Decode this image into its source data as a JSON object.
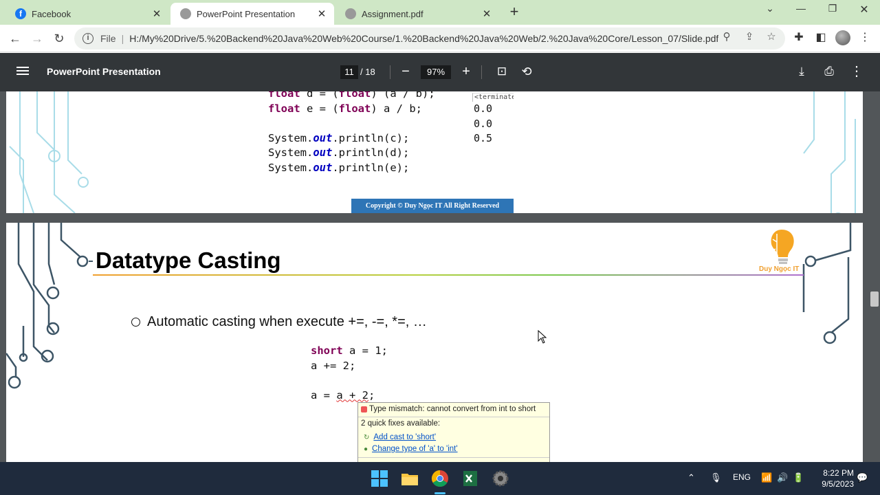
{
  "browser": {
    "tabs": [
      {
        "title": "Facebook",
        "active": false,
        "favicon": "facebook-icon",
        "color": "#1877f2"
      },
      {
        "title": "PowerPoint Presentation",
        "active": true,
        "favicon": "globe-icon",
        "color": "#888888"
      },
      {
        "title": "Assignment.pdf",
        "active": false,
        "favicon": "globe-icon",
        "color": "#888888"
      }
    ],
    "new_tab": "+",
    "address": {
      "scheme_label": "File",
      "url": "H:/My%20Drive/5.%20Backend%20Java%20Web%20Course/1.%20Backend%20Java%20Web/2.%20Java%20Core/Lesson_07/Slide.pdf"
    }
  },
  "pdf_toolbar": {
    "title": "PowerPoint Presentation",
    "current_page": "11",
    "total_pages": "/ 18",
    "zoom": "97%"
  },
  "slide_prev": {
    "code_lines": [
      [
        [
          "kw",
          "float"
        ],
        [
          "t",
          " d = ("
        ],
        [
          "kw",
          "float"
        ],
        [
          "t",
          ") (a / b);"
        ]
      ],
      [
        [
          "kw",
          "float"
        ],
        [
          "t",
          " e = ("
        ],
        [
          "kw",
          "float"
        ],
        [
          "t",
          ") a / b;"
        ]
      ],
      [
        [
          "t",
          ""
        ]
      ],
      [
        [
          "t",
          "System."
        ],
        [
          "fld",
          "out"
        ],
        [
          "t",
          ".println(c);"
        ]
      ],
      [
        [
          "t",
          "System."
        ],
        [
          "fld",
          "out"
        ],
        [
          "t",
          ".println(d);"
        ]
      ],
      [
        [
          "t",
          "System."
        ],
        [
          "fld",
          "out"
        ],
        [
          "t",
          ".println(e);"
        ]
      ]
    ],
    "console_header": "<terminated",
    "console_values": [
      "0.0",
      "0.0",
      "0.5"
    ],
    "copyright": "Copyright © Duy Ngọc IT All Right Reserved"
  },
  "slide_current": {
    "title": "Datatype Casting",
    "bullet": "Automatic casting when execute +=, -=, *=, …",
    "code": {
      "line1_kw": "short",
      "line1_rest": " a = 1;",
      "line2": "a += 2;",
      "line3_pre": "a = ",
      "line3_err": "a + 2",
      "line3_post": ";"
    },
    "popup": {
      "error": "Type mismatch: cannot convert from int to short",
      "quick_fixes": "2 quick fixes available:",
      "fix1": "Add cast to 'short'",
      "fix2": "Change type of 'a' to 'int'"
    },
    "logo_text": "Duy Ngọc IT"
  },
  "taskbar": {
    "language": "ENG",
    "time": "8:22 PM",
    "date": "9/5/2023"
  }
}
